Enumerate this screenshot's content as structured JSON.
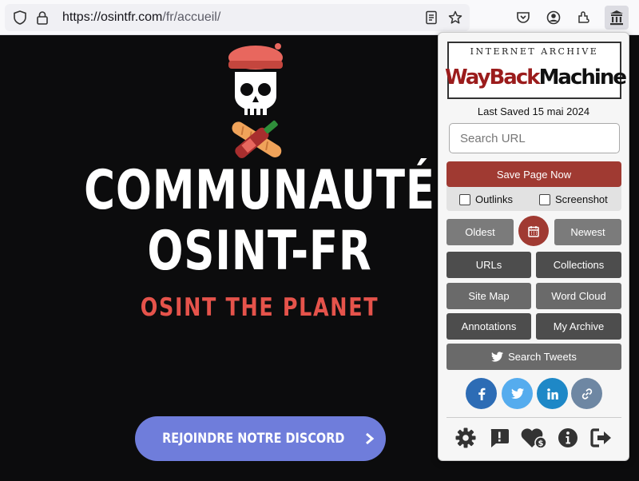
{
  "browser": {
    "url_host": "https://osintfr.com",
    "url_path": "/fr/accueil/"
  },
  "page": {
    "title_line1": "COMMUNAUTÉ",
    "title_line2": "OSINT-FR",
    "subtitle": "OSINT THE PLANET",
    "cta_label": "REJOINDRE NOTRE DISCORD"
  },
  "wayback": {
    "logo_top": "INTERNET ARCHIVE",
    "logo_main": "WayBack",
    "logo_main_2": "Machine",
    "last_saved": "Last Saved 15 mai 2024",
    "search_placeholder": "Search URL",
    "save_label": "Save Page Now",
    "outlinks_label": "Outlinks",
    "screenshot_label": "Screenshot",
    "oldest_label": "Oldest",
    "newest_label": "Newest",
    "urls_label": "URLs",
    "collections_label": "Collections",
    "sitemap_label": "Site Map",
    "wordcloud_label": "Word Cloud",
    "annotations_label": "Annotations",
    "myarchive_label": "My Archive",
    "tweets_label": "Search Tweets",
    "colors": {
      "accent_red": "#a03a32",
      "facebook": "#2d6cb5",
      "twitter": "#55acee",
      "linkedin": "#1e88c7",
      "link": "#6e87a3"
    }
  },
  "hero_colors": {
    "subtitle": "#e5534b",
    "cta": "#6f7ddb"
  }
}
